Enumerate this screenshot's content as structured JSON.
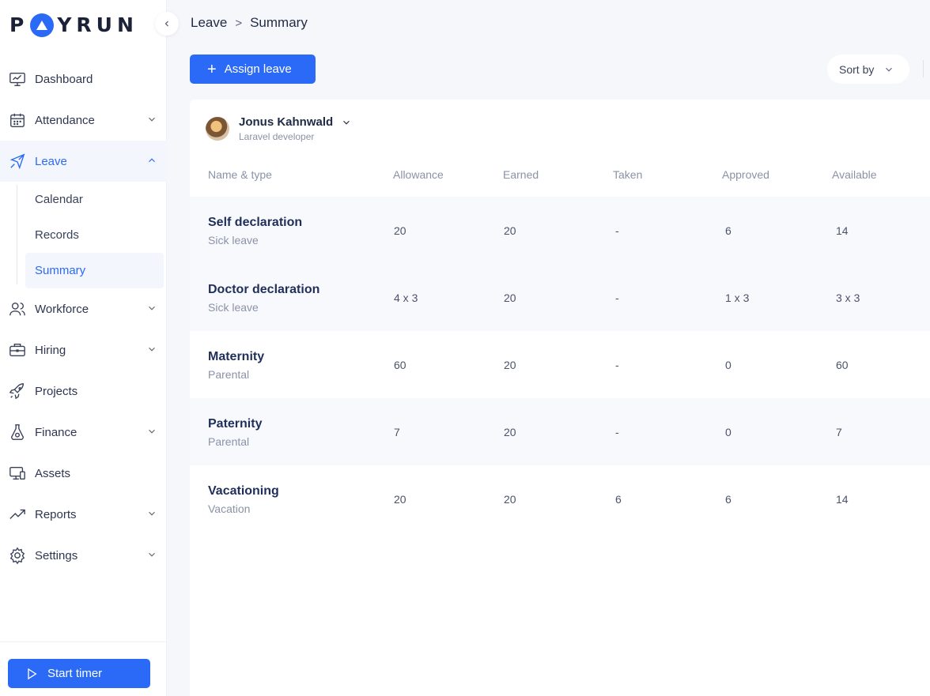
{
  "app": {
    "logo_text_left": "P",
    "logo_text_right": "YRUN"
  },
  "sidebar": {
    "items": [
      {
        "label": "Dashboard",
        "icon": "monitor-icon"
      },
      {
        "label": "Attendance",
        "icon": "calendar-icon"
      },
      {
        "label": "Leave",
        "icon": "airplane-icon"
      },
      {
        "label": "Workforce",
        "icon": "users-icon"
      },
      {
        "label": "Hiring",
        "icon": "briefcase-icon"
      },
      {
        "label": "Projects",
        "icon": "rocket-icon"
      },
      {
        "label": "Finance",
        "icon": "flask-icon"
      },
      {
        "label": "Assets",
        "icon": "devices-icon"
      },
      {
        "label": "Reports",
        "icon": "trend-icon"
      },
      {
        "label": "Settings",
        "icon": "gear-icon"
      }
    ],
    "leave_sub": [
      "Calendar",
      "Records",
      "Summary"
    ],
    "start_timer": "Start timer"
  },
  "breadcrumb": {
    "parent": "Leave",
    "current": "Summary",
    "separator": ">"
  },
  "toolbar": {
    "assign_label": "Assign leave",
    "sort_label": "Sort by"
  },
  "employee": {
    "name": "Jonus Kahnwald",
    "role": "Laravel developer"
  },
  "table": {
    "headers": [
      "Name & type",
      "Allowance",
      "Earned",
      "Taken",
      "Approved",
      "Available"
    ],
    "rows": [
      {
        "name": "Self declaration",
        "type": "Sick leave",
        "allowance": "20",
        "earned": "20",
        "taken": "-",
        "approved": "6",
        "available": "14"
      },
      {
        "name": "Doctor declaration",
        "type": "Sick leave",
        "allowance": "4 x 3",
        "earned": "20",
        "taken": "-",
        "approved": "1 x 3",
        "available": "3 x 3"
      },
      {
        "name": "Maternity",
        "type": "Parental",
        "allowance": "60",
        "earned": "20",
        "taken": "-",
        "approved": "0",
        "available": "60"
      },
      {
        "name": "Paternity",
        "type": "Parental",
        "allowance": "7",
        "earned": "20",
        "taken": "-",
        "approved": "0",
        "available": "7"
      },
      {
        "name": "Vacationing",
        "type": "Vacation",
        "allowance": "20",
        "earned": "20",
        "taken": "6",
        "approved": "6",
        "available": "14"
      }
    ]
  },
  "colors": {
    "accent": "#2b6af6",
    "text": "#1f2a44",
    "muted": "#8a92a6"
  }
}
